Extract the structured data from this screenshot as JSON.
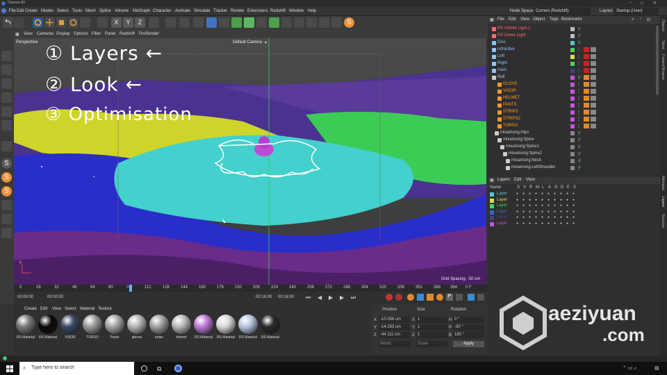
{
  "app": {
    "title": "Cinema 4D"
  },
  "menubar": {
    "items": [
      "File",
      "Edit",
      "Create",
      "Modes",
      "Select",
      "Tools",
      "Mesh",
      "Spline",
      "Volume",
      "MoGraph",
      "Character",
      "Animate",
      "Simulate",
      "Tracker",
      "Render",
      "Extensions",
      "Redshift",
      "Window",
      "Help"
    ],
    "node_space_label": "Node Space:",
    "node_space_value": "Current (Redshift)",
    "layout_label": "Layout:",
    "layout_value": "Startup (User)"
  },
  "viewport": {
    "menu": [
      "View",
      "Cameras",
      "Display",
      "Options",
      "Filter",
      "Panel",
      "Redshift",
      "ProRender"
    ],
    "name": "Perspective",
    "camera": "Default Camera",
    "grid_spacing": "Grid Spacing : 50 cm",
    "annotations": [
      "① Layers ←",
      "② Look ←",
      "③ Optimisation"
    ]
  },
  "timeline": {
    "ticks": [
      "0",
      "16",
      "32",
      "48",
      "64",
      "80",
      "96",
      "112",
      "128",
      "144",
      "160",
      "176",
      "192",
      "208",
      "224",
      "240",
      "256",
      "272",
      "288",
      "304",
      "320",
      "336",
      "352",
      "368",
      "384"
    ],
    "current_frame": "96",
    "end_label": "0 F",
    "start_time": "00:00:00",
    "current_time": "00:00:00",
    "min_time": "00:16:00",
    "max_time": "00:16:00"
  },
  "materials": {
    "menu": [
      "Create",
      "Edit",
      "View",
      "Select",
      "Material",
      "Texture"
    ],
    "items": [
      {
        "label": "RS Material",
        "color": "#7a7a7a"
      },
      {
        "label": "RS Material",
        "color": "#0a0a0a"
      },
      {
        "label": "VISOR",
        "color": "#3c4a66"
      },
      {
        "label": "TORSO",
        "color": "#9a9a9a"
      },
      {
        "label": "Pants",
        "color": "#a5a5a5"
      },
      {
        "label": "gloves",
        "color": "#b5b5b5"
      },
      {
        "label": "strips",
        "color": "#a0a0a0"
      },
      {
        "label": "helmet",
        "color": "#b8b8b8"
      },
      {
        "label": "RS Material",
        "color": "#c07ad8"
      },
      {
        "label": "RS Material",
        "color": "#d8d8d8"
      },
      {
        "label": "RS Material",
        "color": "#b8c6e0"
      },
      {
        "label": "RS Material",
        "color": "#2a2a2a"
      }
    ]
  },
  "attributes": {
    "headers": [
      "Position",
      "Size",
      "Rotation"
    ],
    "rows": [
      {
        "axis": "X",
        "pos": "-10.056 cm",
        "size": "1",
        "rot_axis": "H",
        "rot": "0 °"
      },
      {
        "axis": "Y",
        "pos": "-14.193 cm",
        "size": "1",
        "rot_axis": "P",
        "rot": "-90 °"
      },
      {
        "axis": "Z",
        "pos": "-44.111 cm",
        "size": "1",
        "rot_axis": "B",
        "rot": "180 °"
      }
    ],
    "coord_mode": "World",
    "size_mode": "Scale",
    "apply_label": "Apply"
  },
  "object_manager": {
    "menu": [
      "File",
      "Edit",
      "View",
      "Object",
      "Tags",
      "Bookmarks"
    ],
    "objects": [
      {
        "name": "RS Infinite Light.2",
        "color": "#ff6a6a",
        "dot": "#bbbbbb"
      },
      {
        "name": "RS Dome Light",
        "color": "#ff6a6a",
        "dot": "#bbbbbb"
      },
      {
        "name": "Disc",
        "color": "#8fc2ff",
        "dot": "#56c8d0"
      },
      {
        "name": "refractive",
        "color": "#8fc2ff",
        "dot": "#4ed05a"
      },
      {
        "name": "Left",
        "color": "#8fc2ff",
        "dot": "#cfe24a"
      },
      {
        "name": "Right",
        "color": "#8fc2ff",
        "dot": "#4ed05a"
      },
      {
        "name": "main",
        "color": "#8fc2ff",
        "dot": "#4b3a8c"
      },
      {
        "name": "Null",
        "color": "#cccccc",
        "dot": "#c154e0"
      },
      {
        "name": "GLOVE",
        "color": "#ff9a2a",
        "dot": "#c154e0"
      },
      {
        "name": "VISOR",
        "color": "#ff9a2a",
        "dot": "#c154e0"
      },
      {
        "name": "HELMET",
        "color": "#ff9a2a",
        "dot": "#c154e0"
      },
      {
        "name": "PANTS",
        "color": "#ff9a2a",
        "dot": "#c154e0"
      },
      {
        "name": "STRIPS",
        "color": "#ff9a2a",
        "dot": "#c154e0"
      },
      {
        "name": "STRIPS2",
        "color": "#ff9a2a",
        "dot": "#c154e0"
      },
      {
        "name": "TORSO",
        "color": "#ff9a2a",
        "dot": "#c154e0"
      },
      {
        "name": "mixamorig:Hips",
        "color": "#cccccc",
        "dot": "#888888"
      },
      {
        "name": "mixamorig:Spine",
        "color": "#cccccc",
        "dot": "#888888"
      },
      {
        "name": "mixamorig:Spine1",
        "color": "#cccccc",
        "dot": "#888888"
      },
      {
        "name": "mixamorig:Spine2",
        "color": "#cccccc",
        "dot": "#888888"
      },
      {
        "name": "mixamorig:Neck",
        "color": "#cccccc",
        "dot": "#888888"
      },
      {
        "name": "mixamorig:LeftShoulder",
        "color": "#cccccc",
        "dot": "#888888"
      }
    ]
  },
  "layer_manager": {
    "menu": [
      "Layers",
      "Edit",
      "View"
    ],
    "name_header": "Name",
    "column_headers": [
      "S",
      "V",
      "R",
      "M",
      "L",
      "A",
      "G",
      "D",
      "E",
      "X"
    ],
    "layers": [
      {
        "name": "Layer",
        "color": "#56c8d0"
      },
      {
        "name": "Layer",
        "color": "#cfe24a"
      },
      {
        "name": "Layer",
        "color": "#4ed05a"
      },
      {
        "name": "Layer",
        "color": "#2f6bc8"
      },
      {
        "name": "Layer",
        "color": "#4b3a8c"
      },
      {
        "name": "Layer",
        "color": "#c154e0"
      }
    ]
  },
  "right_strip": [
    "Objects",
    "Takes",
    "Content Browser",
    "Attributes",
    "Layers",
    "Structure"
  ],
  "watermark": {
    "brand": "aeziyuan",
    ".com": ".com"
  },
  "taskbar": {
    "search_placeholder": "Type here to search"
  }
}
